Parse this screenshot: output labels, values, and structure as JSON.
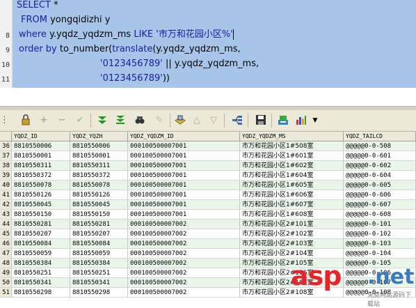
{
  "editor": {
    "line_numbers": [
      "8",
      "9",
      "10",
      "11"
    ],
    "lines": {
      "l1_kw": "SELECT",
      "l1_rest": " *",
      "l2_kw": "FROM",
      "l2_rest": " yongqidizhi y",
      "l3_kw1": "where",
      "l3_mid": " y.yqdz_yqdzm_ms ",
      "l3_kw2": "LIKE",
      "l3_str": " '市万和花园小区%'",
      "l4_kw": "order by",
      "l4_fn": " to_number(",
      "l4_kw2": "translate",
      "l4_rest": "(y.yqdz_yqdzm_ms,",
      "l5_str": "'0123456789'",
      "l5_rest": " || y.yqdz_yqdzm_ms,",
      "l6_str": "'0123456789'",
      "l6_rest": "))"
    }
  },
  "toolbar": {
    "icons": [
      "lock-icon",
      "add-icon",
      "remove-icon",
      "post-check-icon",
      "next-icon",
      "last-icon",
      "find-icon",
      "clear-icon",
      "query-by-example-icon",
      "previous-filter-icon",
      "next-filter-icon",
      "record-view-icon",
      "save-icon",
      "export-icon",
      "chart-icon"
    ],
    "glyphs": [
      "🔒",
      "+",
      "−",
      "✔",
      "⏬",
      "⏬",
      "🔭",
      "✎",
      "▲",
      "▽",
      "▽",
      "⇉",
      "💾",
      "🖫",
      "📊"
    ]
  },
  "grid": {
    "columns": [
      "YQDZ_ID",
      "YQDZ_YQZH",
      "YQDZ_YQDZM_ID",
      "YQDZ_YQDZM_MS",
      "YQDZ_TAILCD"
    ],
    "rows": [
      {
        "n": "36",
        "id": "8810550006",
        "zh": "8810550006",
        "dzm_id": "000100500007001",
        "ms": "市万和花园小区1#508室",
        "tail": "@@@@@0-0-508"
      },
      {
        "n": "37",
        "id": "8810550001",
        "zh": "8810550001",
        "dzm_id": "000100500007001",
        "ms": "市万和花园小区1#601室",
        "tail": "@@@@@0-0-601"
      },
      {
        "n": "38",
        "id": "8810550311",
        "zh": "8810550311",
        "dzm_id": "000100500007001",
        "ms": "市万和花园小区1#602室",
        "tail": "@@@@@0-0-602"
      },
      {
        "n": "39",
        "id": "8810550372",
        "zh": "8810550372",
        "dzm_id": "000100500007001",
        "ms": "市万和花园小区1#604室",
        "tail": "@@@@@0-0-604"
      },
      {
        "n": "40",
        "id": "8810550078",
        "zh": "8810550078",
        "dzm_id": "000100500007001",
        "ms": "市万和花园小区1#605室",
        "tail": "@@@@@0-0-605"
      },
      {
        "n": "41",
        "id": "8810550126",
        "zh": "8810550126",
        "dzm_id": "000100500007001",
        "ms": "市万和花园小区1#606室",
        "tail": "@@@@@0-0-606"
      },
      {
        "n": "42",
        "id": "8810550045",
        "zh": "8810550045",
        "dzm_id": "000100500007001",
        "ms": "市万和花园小区1#607室",
        "tail": "@@@@@0-0-607"
      },
      {
        "n": "43",
        "id": "8810550150",
        "zh": "8810550150",
        "dzm_id": "000100500007001",
        "ms": "市万和花园小区1#608室",
        "tail": "@@@@@0-0-608"
      },
      {
        "n": "44",
        "id": "8810550281",
        "zh": "8810550281",
        "dzm_id": "000100500007002",
        "ms": "市万和花园小区2#101室",
        "tail": "@@@@@0-0-101"
      },
      {
        "n": "45",
        "id": "8810550207",
        "zh": "8810550207",
        "dzm_id": "000100500007002",
        "ms": "市万和花园小区2#102室",
        "tail": "@@@@@0-0-102"
      },
      {
        "n": "46",
        "id": "8810550084",
        "zh": "8810550084",
        "dzm_id": "000100500007002",
        "ms": "市万和花园小区2#103室",
        "tail": "@@@@@0-0-103"
      },
      {
        "n": "47",
        "id": "8810550059",
        "zh": "8810550059",
        "dzm_id": "000100500007002",
        "ms": "市万和花园小区2#104室",
        "tail": "@@@@@0-0-104"
      },
      {
        "n": "48",
        "id": "8810550384",
        "zh": "8810550384",
        "dzm_id": "000100500007002",
        "ms": "市万和花园小区2#105室",
        "tail": "@@@@@0-0-105"
      },
      {
        "n": "49",
        "id": "8810550251",
        "zh": "8810550251",
        "dzm_id": "000100500007002",
        "ms": "市万和花园小区2#106室",
        "tail": "@@@@@0-0-106"
      },
      {
        "n": "50",
        "id": "8810550341",
        "zh": "8810550341",
        "dzm_id": "000100500007002",
        "ms": "市万和花园小区2#107室",
        "tail": "@@@@@0-0-107"
      },
      {
        "n": "51",
        "id": "8810550298",
        "zh": "8810550298",
        "dzm_id": "000100500007002",
        "ms": "市万和花园小区2#108室",
        "tail": "@@@@@0-0-108"
      }
    ]
  },
  "watermark": {
    "brand": "asp",
    "suffix": ".net",
    "sub": "免费网站源码下载站"
  }
}
